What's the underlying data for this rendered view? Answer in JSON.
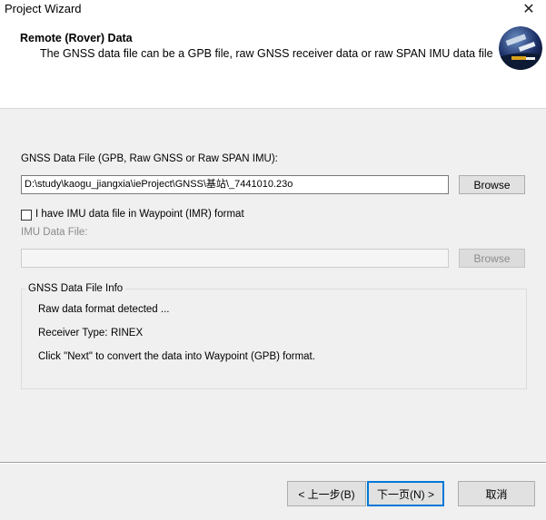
{
  "window": {
    "title": "Project Wizard",
    "close_glyph": "✕"
  },
  "header": {
    "title": "Remote (Rover) Data",
    "description": "The GNSS data file can be a GPB file, raw GNSS receiver data or raw SPAN IMU data file",
    "logo_icon": "satellite-logo"
  },
  "gnss_file": {
    "label": "GNSS Data File (GPB, Raw GNSS or Raw SPAN IMU):",
    "value": "D:\\study\\kaogu_jiangxia\\ieProject\\GNSS\\基站\\_7441010.23o",
    "browse_label": "Browse"
  },
  "imu": {
    "checkbox_label": "I have IMU data file in Waypoint (IMR) format",
    "checked": false,
    "file_label": "IMU Data File:",
    "value": "",
    "browse_label": "Browse"
  },
  "info_group": {
    "title": "GNSS Data File Info",
    "line1": "Raw data format detected ...",
    "receiver_type_label": "Receiver Type:",
    "receiver_type_value": "RINEX",
    "line3": "Click \"Next\" to convert the data into Waypoint (GPB) format."
  },
  "footer": {
    "back_label": "< 上一步(B)",
    "next_label": "下一页(N) >",
    "cancel_label": "取消"
  }
}
